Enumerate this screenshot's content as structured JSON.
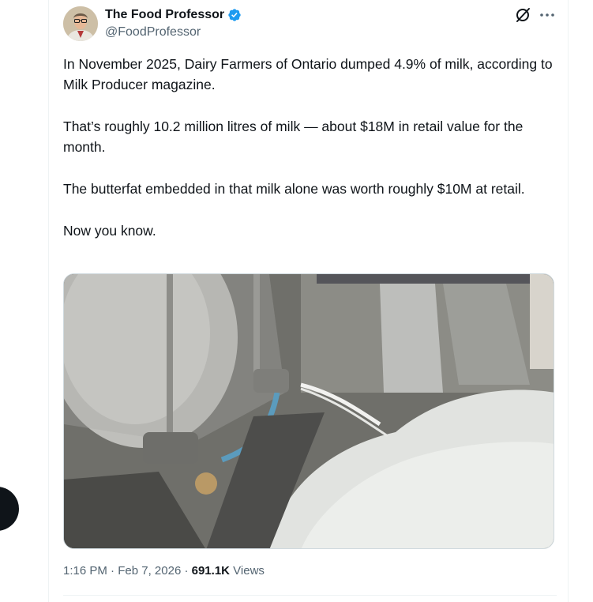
{
  "author": {
    "display_name": "The Food Professor",
    "handle": "@FoodProfessor",
    "verified": true,
    "verified_color": "#1d9bf0"
  },
  "tweet": {
    "paragraphs": [
      "In November 2025, Dairy Farmers of Ontario dumped 4.9% of milk, according to Milk Producer magazine.",
      "That’s roughly 10.2 million litres of milk — about $18M in retail value for the month.",
      "The butterfat embedded in that milk alone was worth roughly $10M at retail.",
      "Now you know."
    ]
  },
  "meta": {
    "time": "1:16 PM",
    "separator": " · ",
    "date": "Feb 7, 2026",
    "views_count": "691.1K",
    "views_label": "Views"
  },
  "icons": {
    "grok": "grok-icon",
    "more": "more-options-icon",
    "verified": "verified-badge-icon"
  }
}
